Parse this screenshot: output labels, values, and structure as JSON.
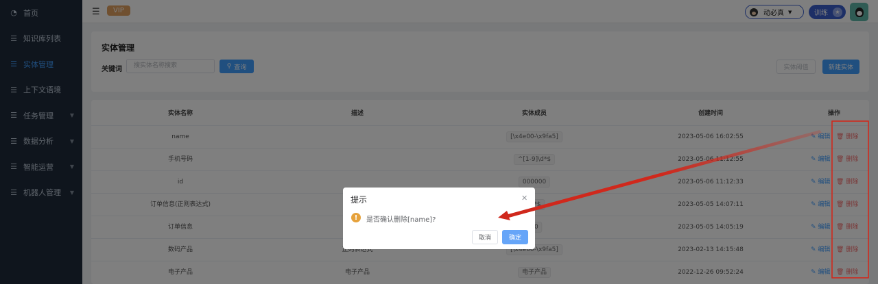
{
  "sidebar": {
    "items": [
      {
        "label": "首页",
        "icon": "dashboard-icon",
        "has_children": false,
        "active": false
      },
      {
        "label": "知识库列表",
        "icon": "list-icon",
        "has_children": false,
        "active": false
      },
      {
        "label": "实体管理",
        "icon": "list-icon",
        "has_children": false,
        "active": true
      },
      {
        "label": "上下文语境",
        "icon": "list-icon",
        "has_children": false,
        "active": false
      },
      {
        "label": "任务管理",
        "icon": "list-icon",
        "has_children": true,
        "active": false
      },
      {
        "label": "数据分析",
        "icon": "list-icon",
        "has_children": true,
        "active": false
      },
      {
        "label": "智能运营",
        "icon": "list-icon",
        "has_children": true,
        "active": false
      },
      {
        "label": "机器人管理",
        "icon": "list-icon",
        "has_children": true,
        "active": false
      }
    ]
  },
  "header": {
    "vip_label": "VIP",
    "user_name": "动必真",
    "train_label": "训练"
  },
  "search": {
    "title": "实体管理",
    "keyword_label": "关键词",
    "keyword_placeholder": "搜实体名称搜索",
    "query_button": "查询",
    "threshold_button": "实体阈值",
    "new_button": "新建实体"
  },
  "table": {
    "columns": [
      "实体名称",
      "描述",
      "实体成员",
      "创建时间",
      "操作"
    ],
    "edit_label": "编辑",
    "delete_label": "删除",
    "rows": [
      {
        "name": "name",
        "desc": "",
        "member": "[\\x4e00-\\x9fa5]",
        "time": "2023-05-06 16:02:55"
      },
      {
        "name": "手机号码",
        "desc": "",
        "member": "^[1-9]\\d*$",
        "time": "2023-05-06 11:12:55"
      },
      {
        "name": "id",
        "desc": "",
        "member": "000000",
        "time": "2023-05-06 11:12:33"
      },
      {
        "name": "订单信息(正则表达式)",
        "desc": "",
        "member": "\\d*$",
        "time": "2023-05-05 14:07:11"
      },
      {
        "name": "订单信息",
        "desc": "",
        "member": "00",
        "time": "2023-05-05 14:05:19"
      },
      {
        "name": "数码产品",
        "desc": "正则表达式",
        "member": "[\\x4e00-\\x9fa5]",
        "time": "2023-02-13 14:15:48"
      },
      {
        "name": "电子产品",
        "desc": "电子产品",
        "member": "电子产品",
        "time": "2022-12-26 09:52:24"
      }
    ]
  },
  "dialog": {
    "title": "提示",
    "message": "是否确认删除[name]?",
    "cancel": "取消",
    "confirm": "确定"
  },
  "colors": {
    "sidebar_bg": "#1f2a3a",
    "primary": "#409eff",
    "danger": "#f56c6c",
    "warning": "#e6a23c",
    "annotation": "#d0281c"
  }
}
